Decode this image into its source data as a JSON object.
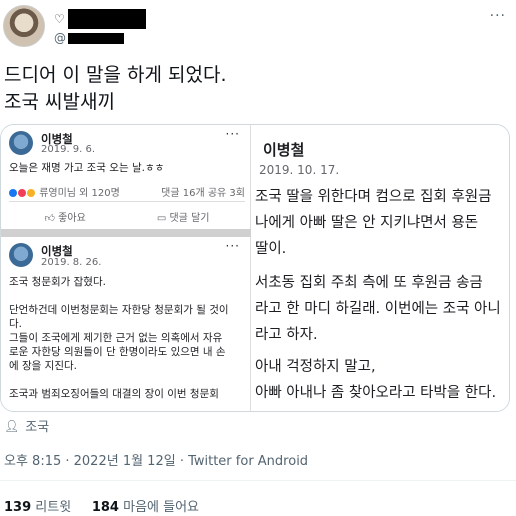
{
  "header": {
    "more": "···",
    "handle_prefix": "@"
  },
  "tweet": {
    "line1": "드디어 이 말을 하게 되었다.",
    "line2": "조국 씨발새끼"
  },
  "media": {
    "right": {
      "name": "이병철",
      "date": "2019. 10. 17.",
      "lines": [
        "조국 딸을 위한다며 컴으로 집회 후원금",
        "나에게 아빠 딸은 안 지키냐면서 용돈",
        "딸이.",
        "서초동 집회 주최 측에 또 후원금 송금",
        "라고 한 마디 하길래. 이번에는 조국 아니",
        "라고 하자.",
        "아내 걱정하지 말고,",
        "아빠 아내나 좀 찾아오라고 타박을 한다."
      ]
    },
    "card1": {
      "name": "이병철",
      "date": "2019. 9. 6.",
      "text": "오늘은 재명 가고 조국 오는 날.ㅎㅎ",
      "reactions": "류영미님 외 120명",
      "counts": "댓글 16개  공유 3회",
      "like": "좋아요",
      "comment": "댓글 달기"
    },
    "card2": {
      "name": "이병철",
      "date": "2019. 8. 26.",
      "lines": [
        "조국 청문회가 잡혔다.",
        "",
        "단언하건데 이번청문회는 자한당 청문회가 될 것이",
        "다.",
        "그들이 조국에게 제기한 근거 없는 의혹에서 자유",
        "로운 자한당 의원들이 단 한명이라도 있으면 내 손",
        "에 장을 지진다.",
        "",
        "조국과 범죄오징어들의 대결의 장이 이번 청문회"
      ]
    }
  },
  "location": "조국",
  "timestamp": "오후 8:15 · 2022년 1월 12일 · Twitter for Android",
  "stats": {
    "retweets": "139",
    "retweets_label": "리트윗",
    "likes": "184",
    "likes_label": "마음에 들어요"
  }
}
